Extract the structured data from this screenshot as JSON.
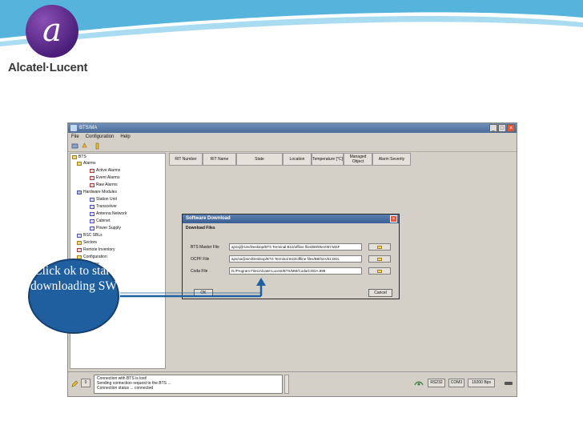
{
  "brand": {
    "name": "Alcatel·Lucent",
    "mark": "a"
  },
  "colors": {
    "swoosh": "#56b4dc",
    "callout": "#1f5f9f",
    "callout_border": "#163f6e",
    "logo_purple": "#4b1f7a"
  },
  "window": {
    "title": "BTS/MA",
    "menu": [
      "File",
      "Configuration",
      "Help"
    ]
  },
  "tree": {
    "items": [
      {
        "label": "BTS",
        "icon": "computer-icon"
      },
      {
        "label": "Alarms",
        "icon": "alarm-bell-icon"
      },
      {
        "label": "Active Alarms",
        "icon": "alarm-list-icon"
      },
      {
        "label": "Event Alarms",
        "icon": "alarm-list-icon"
      },
      {
        "label": "Raw Alarms",
        "icon": "alarm-list-icon"
      },
      {
        "label": "Hardware Modules",
        "icon": "hardware-icon"
      },
      {
        "label": "Station Unit",
        "icon": "module-icon"
      },
      {
        "label": "Transceiver",
        "icon": "module-icon"
      },
      {
        "label": "Antenna Network",
        "icon": "module-icon"
      },
      {
        "label": "Cabinet",
        "icon": "module-icon"
      },
      {
        "label": "Power Supply",
        "icon": "module-icon"
      },
      {
        "label": "BSC SBLs",
        "icon": "module-icon"
      },
      {
        "label": "Sectors",
        "icon": "antenna-icon"
      },
      {
        "label": "Remote Inventory",
        "icon": "inventory-icon"
      },
      {
        "label": "Configuration",
        "icon": "config-icon"
      },
      {
        "label": "Software",
        "icon": "config-icon"
      }
    ]
  },
  "table": {
    "columns": [
      "RIT Number",
      "RIT Name",
      "State",
      "Location",
      "Temperature [°C]",
      "Managed Object",
      "Alarm Severity"
    ]
  },
  "dialog": {
    "title": "Software Download",
    "section": "Download Files",
    "rows": [
      {
        "label": "BTS Master File",
        "path": "ajsraj@sim/Desktop/BTS Terminal B10/offline files/B9/05A/05Y.MSF"
      },
      {
        "label": "OCPF File",
        "path": "aps/sa@sim/Desktop/BTS Terminal B10/offline files/B9/02A/02.DDL"
      },
      {
        "label": "Coda File",
        "path": "D:/Program Files/Alcatel-Lucent/BTS/MM/Coda/CODA.998"
      }
    ],
    "ok_label": "OK",
    "cancel_label": "Cancel"
  },
  "status": {
    "log": [
      "Connection with BTS is lost!",
      "Sending connection request to the BTS ...",
      "Connection status ... connected"
    ],
    "port": "RS232",
    "com": "COM3",
    "baud": "19200 Bps",
    "indicator": "0"
  },
  "callout": {
    "text": "Click ok to start downloading SW"
  }
}
